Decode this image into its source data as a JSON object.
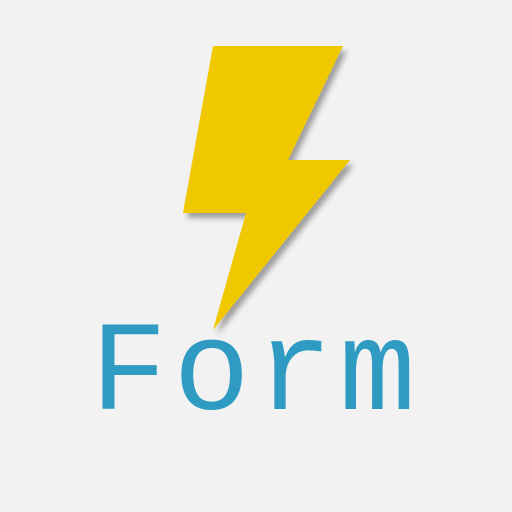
{
  "logo": {
    "word": "Form",
    "icon": "lightning-bolt-icon",
    "colors": {
      "background": "#f2f2f2",
      "bolt": "#f0c800",
      "word": "#2f9bc2"
    }
  }
}
